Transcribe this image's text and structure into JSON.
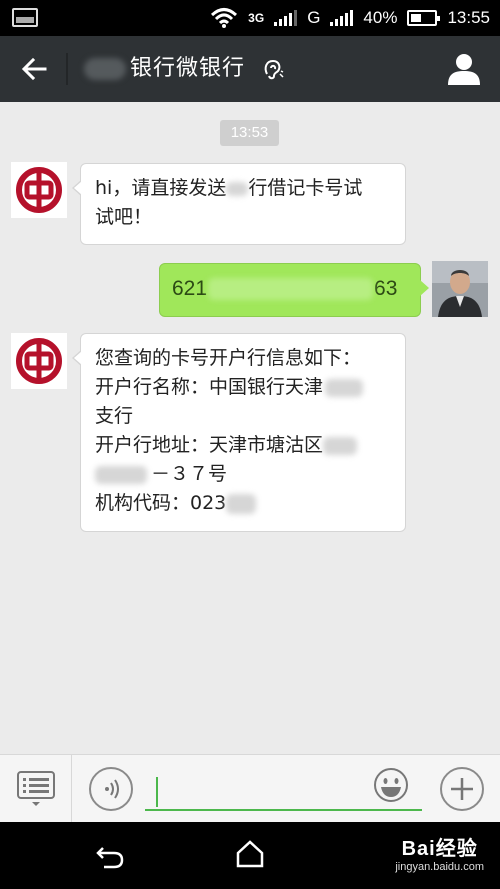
{
  "status_bar": {
    "network_3g": "3G",
    "network_g": "G",
    "battery_percent": "40%",
    "time": "13:55"
  },
  "title_bar": {
    "title": "银行微银行",
    "back_icon": "arrow-left-icon",
    "earpiece_icon": "earpiece-mode-icon",
    "profile_icon": "person-icon"
  },
  "chat": {
    "timestamp": "13:53",
    "messages": [
      {
        "direction": "incoming",
        "sender_avatar": "bank-of-china-logo",
        "lines": [
          "hi，请直接发送",
          "行借记卡号试",
          "试吧！"
        ]
      },
      {
        "direction": "outgoing",
        "card_prefix": "621",
        "card_suffix": "63"
      },
      {
        "direction": "incoming",
        "sender_avatar": "bank-of-china-logo",
        "lines": [
          "您查询的卡号开户行信息如下：",
          "开户行名称：中国银行天津",
          "支行",
          "开户行地址：天津市塘沽区",
          "－３７号",
          "机构代码：023"
        ]
      }
    ]
  },
  "input_bar": {
    "menu_icon": "menu-list-icon",
    "voice_icon": "voice-input-icon",
    "text_value": "",
    "emoji_icon": "emoji-icon",
    "more_icon": "plus-icon"
  },
  "nav_bar": {
    "back_icon": "back-icon",
    "home_icon": "home-icon",
    "watermark_brand": "Bai经验",
    "watermark_url": "jingyan.baidu.com"
  },
  "colors": {
    "title_bar": "#2e3235",
    "outgoing_bubble": "#a0e75a",
    "incoming_bubble": "#ffffff",
    "background": "#ebebeb",
    "bank_logo": "#b5112b",
    "input_accent": "#4cb84c"
  }
}
